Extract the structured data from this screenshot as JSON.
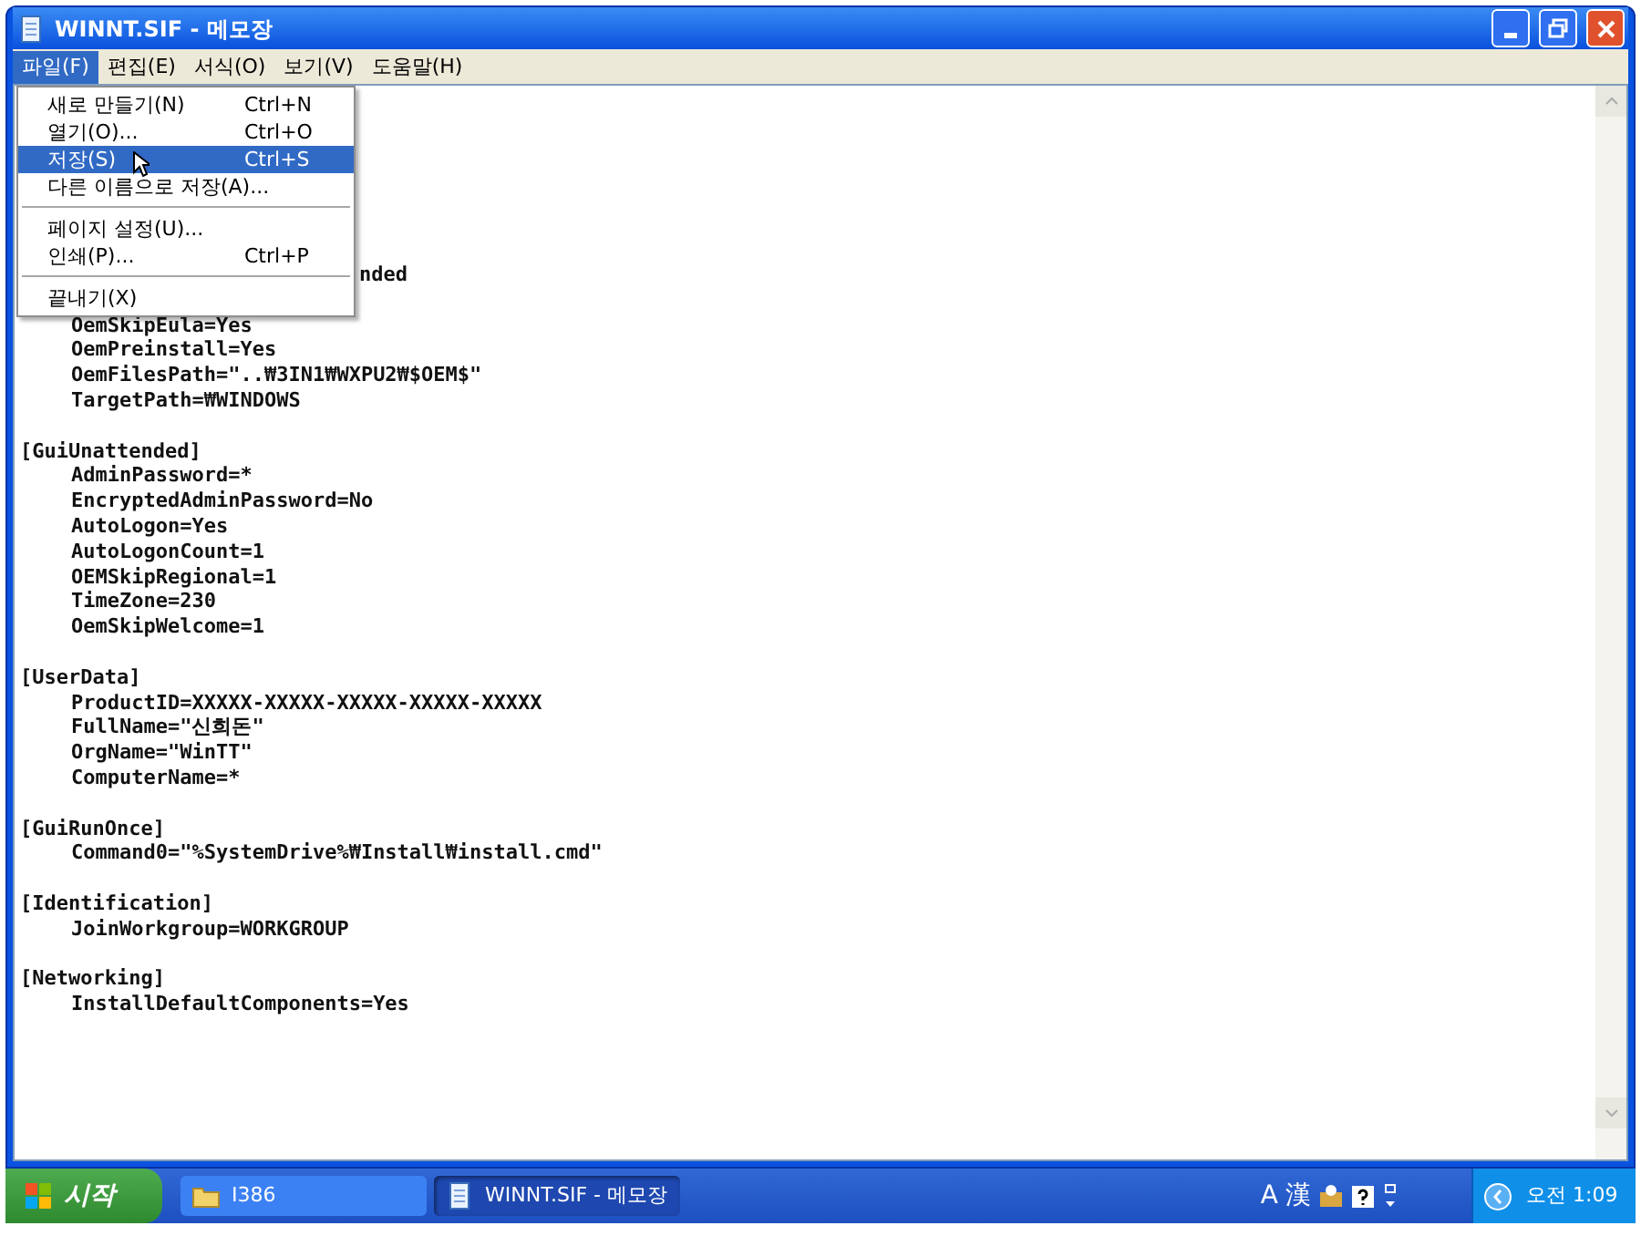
{
  "window": {
    "title": "WINNT.SIF - 메모장"
  },
  "menu_bar": [
    {
      "label": "파일(F)",
      "selected": true
    },
    {
      "label": "편집(E)",
      "selected": false
    },
    {
      "label": "서식(O)",
      "selected": false
    },
    {
      "label": "보기(V)",
      "selected": false
    },
    {
      "label": "도움말(H)",
      "selected": false
    }
  ],
  "file_menu": [
    {
      "kind": "item",
      "label": "새로 만들기(N)",
      "shortcut": "Ctrl+N",
      "selected": false
    },
    {
      "kind": "item",
      "label": "열기(O)...",
      "shortcut": "Ctrl+O",
      "selected": false
    },
    {
      "kind": "item",
      "label": "저장(S)",
      "shortcut": "Ctrl+S",
      "selected": true
    },
    {
      "kind": "item",
      "label": "다른 이름으로 저장(A)...",
      "selected": false
    },
    {
      "kind": "separator"
    },
    {
      "kind": "item",
      "label": "페이지 설정(U)...",
      "selected": false
    },
    {
      "kind": "item",
      "label": "인쇄(P)...",
      "shortcut": "Ctrl+P",
      "selected": false
    },
    {
      "kind": "separator"
    },
    {
      "kind": "item",
      "label": "끝내기(X)",
      "selected": false
    }
  ],
  "editor_lines": [
    {
      "kind": "partial",
      "text": "nded"
    },
    {
      "kind": "blank"
    },
    {
      "kind": "key",
      "text": "OemSkipEula=Yes"
    },
    {
      "kind": "key",
      "text": "OemPreinstall=Yes"
    },
    {
      "kind": "key",
      "text": "OemFilesPath=\"..₩3IN1₩WXPU2₩$OEM$\""
    },
    {
      "kind": "key",
      "text": "TargetPath=₩WINDOWS"
    },
    {
      "kind": "blank"
    },
    {
      "kind": "section",
      "text": "[GuiUnattended]"
    },
    {
      "kind": "key",
      "text": "AdminPassword=*"
    },
    {
      "kind": "key",
      "text": "EncryptedAdminPassword=No"
    },
    {
      "kind": "key",
      "text": "AutoLogon=Yes"
    },
    {
      "kind": "key",
      "text": "AutoLogonCount=1"
    },
    {
      "kind": "key",
      "text": "OEMSkipRegional=1"
    },
    {
      "kind": "key",
      "text": "TimeZone=230"
    },
    {
      "kind": "key",
      "text": "OemSkipWelcome=1"
    },
    {
      "kind": "blank"
    },
    {
      "kind": "section",
      "text": "[UserData]"
    },
    {
      "kind": "key",
      "text": "ProductID=XXXXX-XXXXX-XXXXX-XXXXX-XXXXX"
    },
    {
      "kind": "key",
      "text": "FullName=\"신희돈\""
    },
    {
      "kind": "key",
      "text": "OrgName=\"WinTT\""
    },
    {
      "kind": "key",
      "text": "ComputerName=*"
    },
    {
      "kind": "blank"
    },
    {
      "kind": "section",
      "text": "[GuiRunOnce]"
    },
    {
      "kind": "key",
      "text": "Command0=\"%SystemDrive%₩Install₩install.cmd\""
    },
    {
      "kind": "blank"
    },
    {
      "kind": "section",
      "text": "[Identification]"
    },
    {
      "kind": "key",
      "text": "JoinWorkgroup=WORKGROUP"
    },
    {
      "kind": "blank"
    },
    {
      "kind": "section",
      "text": "[Networking]"
    },
    {
      "kind": "key",
      "text": "InstallDefaultComponents=Yes"
    }
  ],
  "taskbar": {
    "start": "시작",
    "tasks": [
      {
        "kind": "folder",
        "label": "I386",
        "selected": false
      },
      {
        "kind": "notepad",
        "label": "WINNT.SIF - 메모장",
        "selected": true
      }
    ],
    "tray": {
      "ime": [
        "A",
        "漢"
      ],
      "clock": "오전 1:09"
    }
  }
}
